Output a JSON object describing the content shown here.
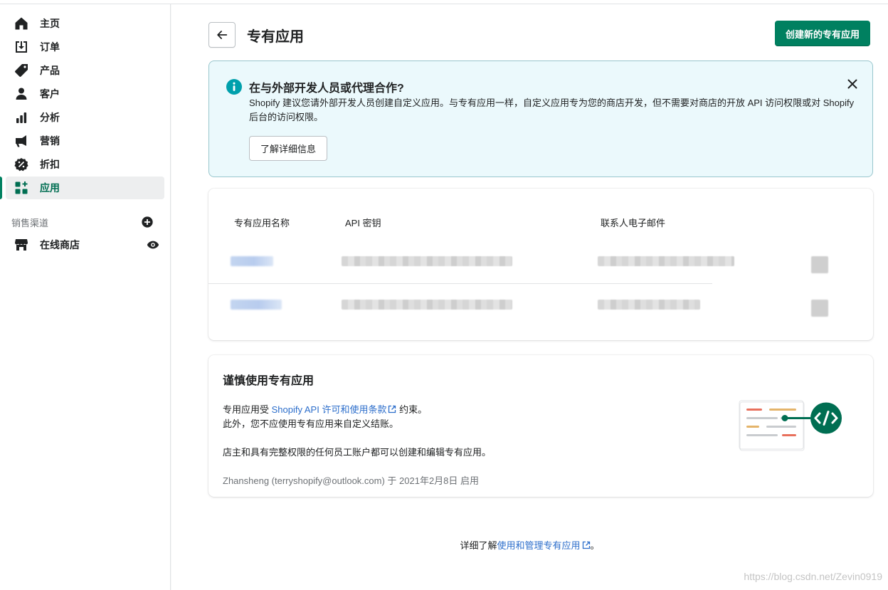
{
  "nav": {
    "items": [
      {
        "label": "主页",
        "icon": "home-icon"
      },
      {
        "label": "订单",
        "icon": "orders-icon"
      },
      {
        "label": "产品",
        "icon": "tag-icon"
      },
      {
        "label": "客户",
        "icon": "customer-icon"
      },
      {
        "label": "分析",
        "icon": "analytics-icon"
      },
      {
        "label": "营销",
        "icon": "megaphone-icon"
      },
      {
        "label": "折扣",
        "icon": "discount-icon"
      },
      {
        "label": "应用",
        "icon": "apps-icon",
        "active": true
      }
    ],
    "sales_channels_title": "销售渠道",
    "online_store_label": "在线商店"
  },
  "header": {
    "title": "专有应用",
    "create_button": "创建新的专有应用"
  },
  "banner": {
    "title": "在与外部开发人员或代理合作?",
    "text": "Shopify 建议您请外部开发人员创建自定义应用。与专有应用一样，自定义应用专为您的商店开发，但不需要对商店的开放 API 访问权限或对 Shopify 后台的访问权限。",
    "button": "了解详细信息"
  },
  "table": {
    "headers": [
      "专有应用名称",
      "API 密钥",
      "联系人电子邮件"
    ],
    "rows_count_note": "2 redacted rows"
  },
  "info": {
    "title": "谨慎使用专有应用",
    "line1_prefix": "专用应用受 ",
    "line1_link": "Shopify API 许可和使用条款",
    "line1_suffix": " 约束。",
    "line2": "此外，您不应使用专有应用来自定义结账。",
    "line3": "店主和具有完整权限的任何员工账户都可以创建和编辑专有应用。",
    "meta": "Zhansheng (terryshopify@outlook.com) 于 2021年2月8日 启用"
  },
  "footer": {
    "prefix": "详细了解",
    "link": "使用和管理专有应用",
    "suffix": "。"
  },
  "watermark": "https://blog.csdn.net/Zevin0919",
  "colors": {
    "primary": "#008060",
    "banner_bg": "#ebf9fc",
    "banner_border": "#98c6cd",
    "link": "#2c6ecb",
    "info_icon": "#00a0ac"
  }
}
